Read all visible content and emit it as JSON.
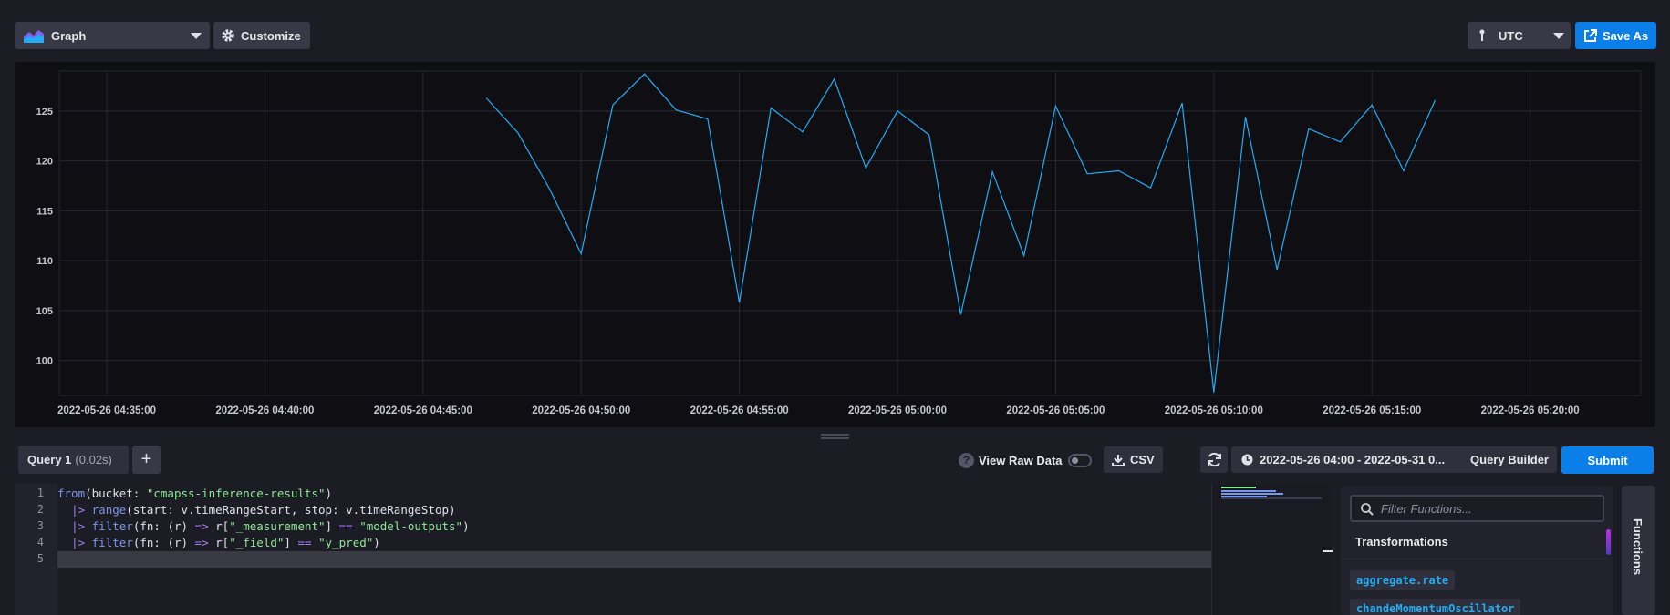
{
  "toolbar": {
    "graph_type": "Graph",
    "customize_label": "Customize",
    "timezone": "UTC",
    "save_as_label": "Save As"
  },
  "query_bar": {
    "tab_label": "Query 1",
    "tab_time": "(0.02s)",
    "add_label": "+",
    "view_raw_label": "View Raw Data",
    "csv_label": "CSV",
    "time_range": "2022-05-26 04:00 - 2022-05-31 0...",
    "query_builder_label": "Query Builder",
    "submit_label": "Submit"
  },
  "editor": {
    "line_numbers": [
      "1",
      "2",
      "3",
      "4",
      "5"
    ],
    "lines": [
      [
        {
          "t": "from",
          "c": "kw"
        },
        {
          "t": "(bucket: ",
          "c": ""
        },
        {
          "t": "\"cmapss-inference-results\"",
          "c": "str"
        },
        {
          "t": ")",
          "c": ""
        }
      ],
      [
        {
          "t": "  ",
          "c": ""
        },
        {
          "t": "|>",
          "c": "op"
        },
        {
          "t": " ",
          "c": ""
        },
        {
          "t": "range",
          "c": "kw"
        },
        {
          "t": "(start: v.timeRangeStart, stop: v.timeRangeStop)",
          "c": ""
        }
      ],
      [
        {
          "t": "  ",
          "c": ""
        },
        {
          "t": "|>",
          "c": "op"
        },
        {
          "t": " ",
          "c": ""
        },
        {
          "t": "filter",
          "c": "kw"
        },
        {
          "t": "(fn: (r) ",
          "c": ""
        },
        {
          "t": "=>",
          "c": "op"
        },
        {
          "t": " r[",
          "c": ""
        },
        {
          "t": "\"_measurement\"",
          "c": "str"
        },
        {
          "t": "] ",
          "c": ""
        },
        {
          "t": "==",
          "c": "op"
        },
        {
          "t": " ",
          "c": ""
        },
        {
          "t": "\"model-outputs\"",
          "c": "str"
        },
        {
          "t": ")",
          "c": ""
        }
      ],
      [
        {
          "t": "  ",
          "c": ""
        },
        {
          "t": "|>",
          "c": "op"
        },
        {
          "t": " ",
          "c": ""
        },
        {
          "t": "filter",
          "c": "kw"
        },
        {
          "t": "(fn: (r) ",
          "c": ""
        },
        {
          "t": "=>",
          "c": "op"
        },
        {
          "t": " r[",
          "c": ""
        },
        {
          "t": "\"_field\"",
          "c": "str"
        },
        {
          "t": "] ",
          "c": ""
        },
        {
          "t": "==",
          "c": "op"
        },
        {
          "t": " ",
          "c": ""
        },
        {
          "t": "\"y_pred\"",
          "c": "str"
        },
        {
          "t": ")",
          "c": ""
        }
      ],
      []
    ]
  },
  "functions": {
    "filter_placeholder": "Filter Functions...",
    "category": "Transformations",
    "items": [
      "aggregate.rate",
      "chandeMomentumOscillator"
    ],
    "side_label": "Functions"
  },
  "chart_data": {
    "type": "line",
    "line_color": "#22adf6",
    "ylim": [
      96.5,
      129
    ],
    "y_ticks": [
      100,
      105,
      110,
      115,
      120,
      125
    ],
    "x_ticks": [
      "2022-05-26 04:35:00",
      "2022-05-26 04:40:00",
      "2022-05-26 04:45:00",
      "2022-05-26 04:50:00",
      "2022-05-26 04:55:00",
      "2022-05-26 05:00:00",
      "2022-05-26 05:05:00",
      "2022-05-26 05:10:00",
      "2022-05-26 05:15:00",
      "2022-05-26 05:20:00"
    ],
    "xlim": [
      "2022-05-26 04:33:30",
      "2022-05-26 05:23:30"
    ],
    "grid": true,
    "series": [
      {
        "values": [
          [
            "2022-05-26 04:47:00",
            126.3
          ],
          [
            "2022-05-26 04:48:00",
            122.8
          ],
          [
            "2022-05-26 04:49:00",
            117.2
          ],
          [
            "2022-05-26 04:50:00",
            110.7
          ],
          [
            "2022-05-26 04:51:00",
            125.6
          ],
          [
            "2022-05-26 04:52:00",
            128.7
          ],
          [
            "2022-05-26 04:53:00",
            125.1
          ],
          [
            "2022-05-26 04:54:00",
            124.2
          ],
          [
            "2022-05-26 04:55:00",
            105.8
          ],
          [
            "2022-05-26 04:56:00",
            125.3
          ],
          [
            "2022-05-26 04:57:00",
            122.9
          ],
          [
            "2022-05-26 04:58:00",
            128.2
          ],
          [
            "2022-05-26 04:59:00",
            119.3
          ],
          [
            "2022-05-26 05:00:00",
            125.0
          ],
          [
            "2022-05-26 05:01:00",
            122.6
          ],
          [
            "2022-05-26 05:02:00",
            104.6
          ],
          [
            "2022-05-26 05:03:00",
            118.9
          ],
          [
            "2022-05-26 05:04:00",
            110.5
          ],
          [
            "2022-05-26 05:05:00",
            125.5
          ],
          [
            "2022-05-26 05:06:00",
            118.7
          ],
          [
            "2022-05-26 05:07:00",
            119.0
          ],
          [
            "2022-05-26 05:08:00",
            117.3
          ],
          [
            "2022-05-26 05:09:00",
            125.8
          ],
          [
            "2022-05-26 05:10:00",
            96.8
          ],
          [
            "2022-05-26 05:11:00",
            124.4
          ],
          [
            "2022-05-26 05:12:00",
            109.1
          ],
          [
            "2022-05-26 05:13:00",
            123.2
          ],
          [
            "2022-05-26 05:14:00",
            121.9
          ],
          [
            "2022-05-26 05:15:00",
            125.6
          ],
          [
            "2022-05-26 05:16:00",
            119.0
          ],
          [
            "2022-05-26 05:17:00",
            126.1
          ]
        ]
      }
    ]
  }
}
